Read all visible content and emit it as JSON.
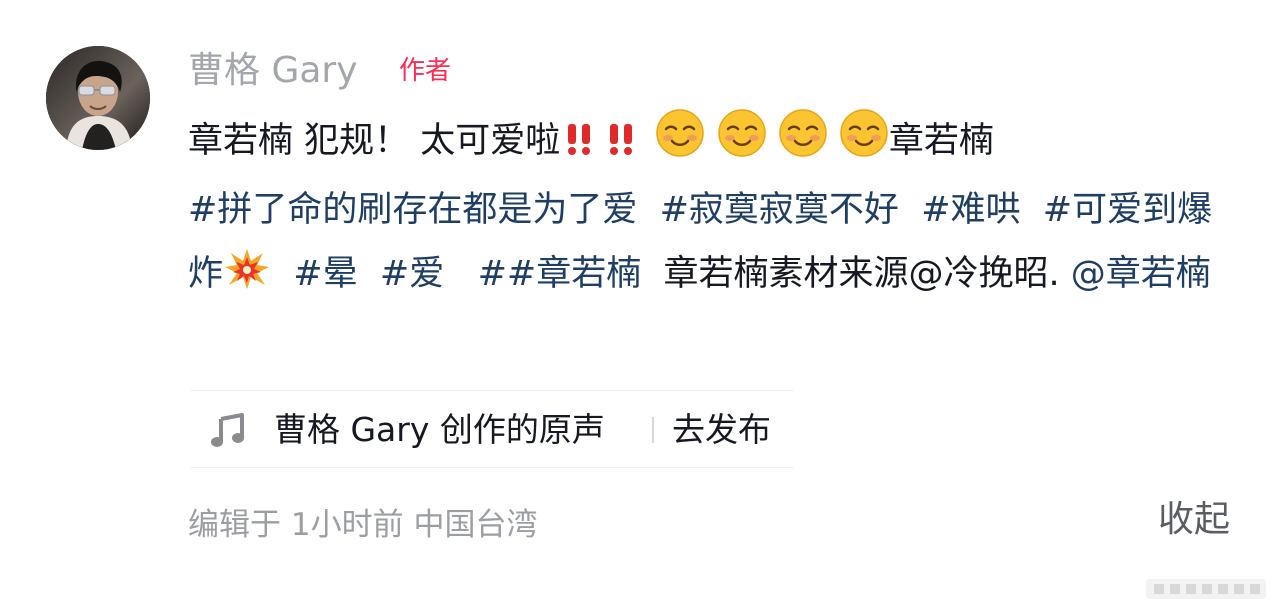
{
  "comment": {
    "author": "曹格 Gary",
    "author_badge": "作者",
    "body_text_1": "章若楠 犯规！ 太可爱啦",
    "body_text_2": "章若楠",
    "hashtags": [
      "#拼了命的刷存在都是为了爱",
      "#寂寞寂寞不好",
      "#难哄",
      "#可爱到爆炸",
      "#晕",
      "#爱",
      "##章若楠"
    ],
    "body_text_3": "章若楠素材来源@冷挽昭.",
    "mention": "@章若楠",
    "emojis": [
      "double-exclamation-icon",
      "double-exclamation-icon",
      "smiling-blush-emoji",
      "smiling-blush-emoji",
      "smiling-blush-emoji",
      "smiling-blush-emoji",
      "collision-emoji"
    ]
  },
  "sound": {
    "name": "曹格 Gary 创作的原声",
    "action": "去发布",
    "icon": "music-note-icon"
  },
  "meta": {
    "edited_prefix": "编辑于",
    "time": "1小时前",
    "location": "中国台湾"
  },
  "actions": {
    "collapse": "收起"
  },
  "colors": {
    "author_name": "#a4a6ad",
    "badge": "#fe2c55",
    "hashtag": "#1f3e63",
    "body": "#161823",
    "meta": "#9c9ea5"
  }
}
